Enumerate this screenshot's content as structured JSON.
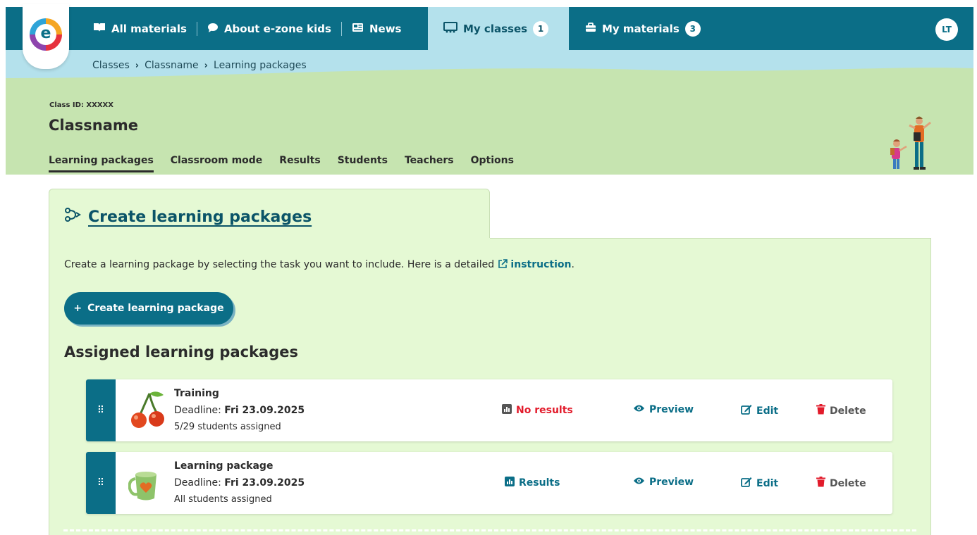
{
  "nav": {
    "items": [
      {
        "label": "All materials",
        "icon": "book-icon"
      },
      {
        "label": "About e-zone kids",
        "icon": "chat-icon"
      },
      {
        "label": "News",
        "icon": "newspaper-icon"
      }
    ],
    "active": {
      "label": "My classes",
      "count": "1",
      "icon": "classroom-icon"
    },
    "materials": {
      "label": "My materials",
      "count": "3",
      "icon": "briefcase-icon"
    },
    "avatar": "LT",
    "logo_letter": "e"
  },
  "breadcrumb": [
    "Classes",
    "Classname",
    "Learning packages"
  ],
  "class": {
    "id_label": "Class ID: XXXXX",
    "name": "Classname"
  },
  "subtabs": [
    "Learning packages",
    "Classroom mode",
    "Results",
    "Students",
    "Teachers",
    "Options"
  ],
  "card": {
    "title": "Create learning packages",
    "intro_text": "Create a learning package by selecting the task you want to include. Here is a detailed",
    "intro_link": "instruction",
    "intro_end": ".",
    "create_button": "Create learning package",
    "create_button_prefix": "+",
    "assigned_title": "Assigned learning packages"
  },
  "packages": [
    {
      "name": "Training",
      "deadline_label": "Deadline:",
      "deadline": "Fri 23.09.2025",
      "assigned": "5/29 students assigned",
      "status": "No results",
      "status_color": "#e21b2b",
      "preview": "Preview",
      "edit": "Edit",
      "delete": "Delete",
      "thumb": "cherries-icon"
    },
    {
      "name": "Learning package",
      "deadline_label": "Deadline:",
      "deadline": "Fri 23.09.2025",
      "assigned": "All students assigned",
      "status": "Results",
      "status_color": "#0b6e87",
      "preview": "Preview",
      "edit": "Edit",
      "delete": "Delete",
      "thumb": "mug-heart-icon"
    }
  ],
  "colors": {
    "primary": "#0b6e87",
    "nav_active": "#b4e1ec",
    "header_green": "#c6e4b0",
    "card_green": "#e5f9d4",
    "danger": "#e21b2b"
  }
}
